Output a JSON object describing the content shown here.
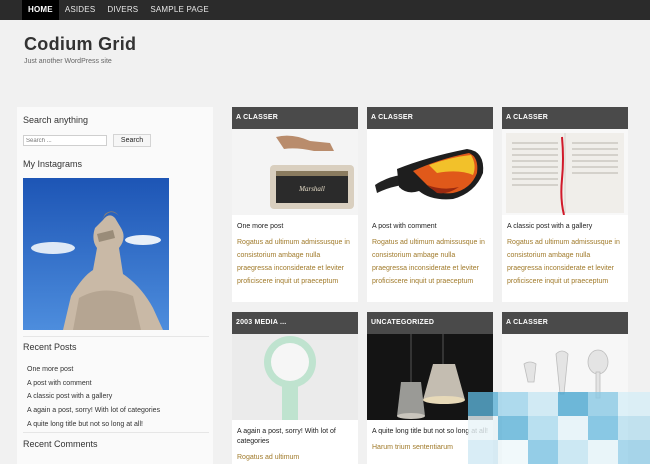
{
  "nav": {
    "items": [
      "HOME",
      "ASIDES",
      "DIVERS",
      "SAMPLE PAGE"
    ]
  },
  "site": {
    "title": "Codium Grid",
    "tagline": "Just another WordPress site"
  },
  "sidebar": {
    "search_heading": "Search anything",
    "search_placeholder": "Search ...",
    "search_button": "Search",
    "instagram_heading": "My Instagrams",
    "recent_posts_heading": "Recent Posts",
    "recent_posts": [
      "One more post",
      "A post with comment",
      "A classic post with a gallery",
      "A again a post, sorry! With lot of categories",
      "A quite long title but not so long at all!"
    ],
    "recent_comments_heading": "Recent Comments"
  },
  "posts": [
    {
      "category": "A CLASSER",
      "title": "One more post",
      "excerpt": "Rogatus ad ultimum admissusque in consistorium ambage nulla praegressa inconsiderate et leviter proficiscere inquit ut praeceptum",
      "image": "speaker"
    },
    {
      "category": "A CLASSER",
      "title": "A post with comment",
      "excerpt": "Rogatus ad ultimum admissusque in consistorium ambage nulla praegressa inconsiderate et leviter proficiscere inquit ut praeceptum",
      "image": "goggles"
    },
    {
      "category": "A CLASSER",
      "title": "A classic post with a gallery",
      "excerpt": "Rogatus ad ultimum admissusque in consistorium ambage nulla praegressa inconsiderate et leviter proficiscere inquit ut praeceptum",
      "image": "book"
    },
    {
      "category": "2003 MEDIA ...",
      "title": "A again a post, sorry! With lot of categories",
      "excerpt": "Rogatus ad ultimum",
      "image": "mint-object"
    },
    {
      "category": "UNCATEGORIZED",
      "title": "A quite long title but not so long at all!",
      "excerpt": "Harum trium sententiarum",
      "image": "lamps"
    },
    {
      "category": "A CLASSER",
      "title": "",
      "excerpt": "",
      "image": "utensils"
    }
  ],
  "colors": {
    "nav_bg": "#2b2b2b",
    "card_header_bg": "#4a4a4a",
    "excerpt_text": "#a07a2a",
    "page_bg": "#f1f1f1"
  }
}
